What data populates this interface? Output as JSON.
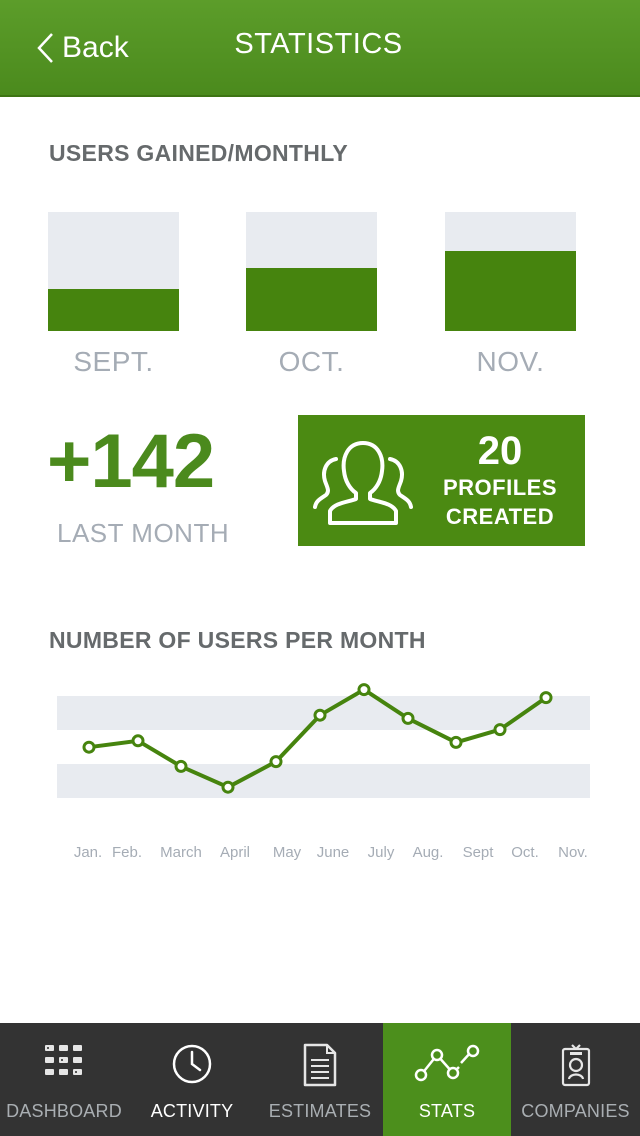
{
  "header": {
    "back_label": "Back",
    "title": "STATISTICS"
  },
  "users_gained": {
    "title": "USERS GAINED/MONTHLY",
    "bars": [
      {
        "label": "SEPT.",
        "fraction": 0.35
      },
      {
        "label": "OCT.",
        "fraction": 0.53
      },
      {
        "label": "NOV.",
        "fraction": 0.67
      }
    ]
  },
  "summary": {
    "value": "+142",
    "caption": "LAST MONTH"
  },
  "profiles": {
    "count": "20",
    "line1": "PROFILES",
    "line2": "CREATED"
  },
  "users_per_month": {
    "title": "NUMBER OF USERS PER MONTH"
  },
  "chart_data": {
    "type": "line",
    "categories": [
      "Jan.",
      "Feb.",
      "March",
      "April",
      "May",
      "June",
      "July",
      "Aug.",
      "Sept",
      "Oct.",
      "Nov."
    ],
    "values": [
      58,
      62,
      46,
      33,
      49,
      78,
      94,
      76,
      61,
      69,
      89
    ],
    "ylim": [
      0,
      100
    ],
    "color": "#46840e",
    "band_color": "#e8ebf0"
  },
  "tabs": [
    {
      "label": "DASHBOARD",
      "icon": "dashboard-icon"
    },
    {
      "label": "ACTIVITY",
      "icon": "clock-icon"
    },
    {
      "label": "ESTIMATES",
      "icon": "document-icon"
    },
    {
      "label": "STATS",
      "icon": "stats-icon"
    },
    {
      "label": "COMPANIES",
      "icon": "id-badge-icon"
    }
  ],
  "colors": {
    "accent": "#4b8a1d",
    "tabbar": "#333333",
    "active_tab": "#4c8f1c"
  }
}
